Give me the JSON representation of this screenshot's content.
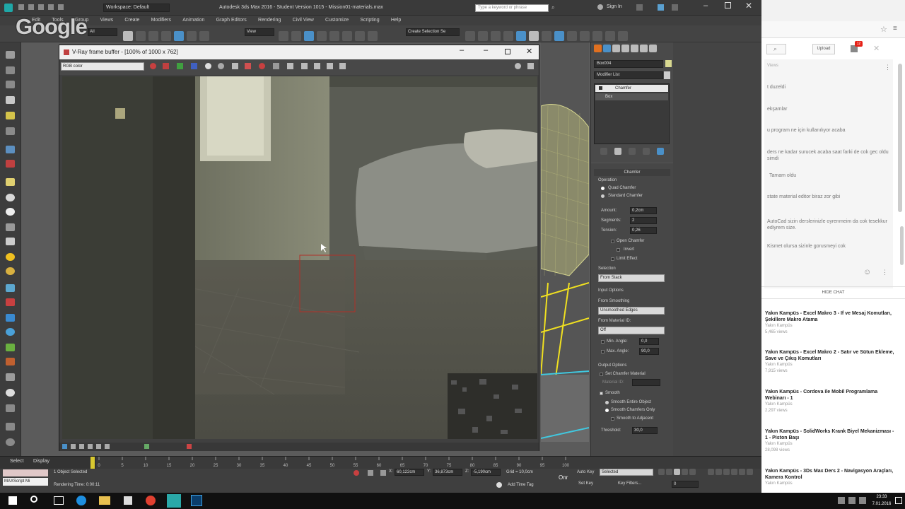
{
  "max": {
    "title": "Autodesk 3ds Max 2016 - Student Version    1015 - Mission01-materials.max",
    "workspace": "Workspace: Default",
    "search_placeholder": "Type a keyword or phrase",
    "signin": "Sign In",
    "menu": [
      "Edit",
      "Tools",
      "Group",
      "Views",
      "Create",
      "Modifiers",
      "Animation",
      "Graph Editors",
      "Rendering",
      "Civil View",
      "Customize",
      "Scripting",
      "Help"
    ],
    "selection_filter": "All",
    "ref_coord": "View",
    "named_sel": "Create Selection Se"
  },
  "vray": {
    "title": "V-Ray frame buffer - [100% of 1000 x 762]",
    "channel": "RGB color"
  },
  "cmd": {
    "object_name": "Box004",
    "modifier_list": "Modifier List",
    "stack": [
      "Chamfer",
      "Box"
    ],
    "chamfer_rollout": "Chamfer",
    "operation_label": "Operation",
    "quad_chamfer": "Quad Chamfer",
    "standard_chamfer": "Standard Chamfer",
    "amount_label": "Amount:",
    "amount": "0,2cm",
    "segments_label": "Segments:",
    "segments": "2",
    "tension_label": "Tension:",
    "tension": "0,26",
    "open_chamfer": "Open Chamfer",
    "invert": "Invert",
    "limit_effect": "Limit Effect",
    "selection_label": "Selection",
    "selection_value": "From Stack",
    "input_options": "Input Options",
    "from_smoothing": "From Smoothing",
    "smoothing_value": "Unsmoothed Edges",
    "from_material": "From Material ID:",
    "material_value": "Off",
    "min_angle_label": "Min. Angle:",
    "min_angle": "0,0",
    "max_angle_label": "Max. Angle:",
    "max_angle": "90,0",
    "output_options": "Output Options",
    "set_material": "Set Chamfer Material",
    "material_id_label": "Material ID:",
    "smooth": "Smooth",
    "smooth_entire": "Smooth Entire Object",
    "smooth_chamfers": "Smooth Chamfers Only",
    "smooth_adjacent": "Smooth to Adjacent",
    "threshold_label": "Threshold:",
    "threshold": "30,0"
  },
  "timeline": {
    "select": "Select",
    "display": "Display",
    "ticks": [
      "0",
      "5",
      "10",
      "15",
      "20",
      "25",
      "30",
      "35",
      "40",
      "45",
      "50",
      "55",
      "60",
      "65",
      "70",
      "75",
      "80",
      "85",
      "90",
      "95",
      "100"
    ]
  },
  "status": {
    "maxscript": "MAXScript Mi",
    "objects_selected": "1 Object Selected",
    "rendering_time": "Rendering Time: 0:00:11",
    "x": "60,122cm",
    "y": "36,873cm",
    "z": "-5,190cm",
    "grid": "Grid = 10,0cm",
    "add_time_tag": "Add Time Tag",
    "auto_key": "Auto Key",
    "selected": "Selected",
    "set_key": "Set Key",
    "key_filters": "Key Filters...",
    "frame": "0"
  },
  "chrome": {
    "upload": "Upload",
    "notif_count": "12",
    "chat_views": "Views",
    "chats": [
      "t duzeldi",
      "ekşamlar",
      "u program ne için kullanılıyor acaba",
      "ders ne kadar surucek acaba  saat farki de cok gec oldu simdi",
      "Tamam oldu",
      "state material editor biraz zor gibi",
      "AutoCad sizin derslerinizle oyrenmeim  da cok tesekkur ediyrem size.",
      "Kismet olursa sizinle gorusmeyi cok"
    ],
    "hide_chat": "HIDE CHAT",
    "videos": [
      {
        "title": "Yakın Kampüs - Excel Makro 3 - If ve Mesaj Komutları, Şekillere Makro Atama",
        "channel": "Yakın Kampüs",
        "views": "5,465 views"
      },
      {
        "title": "Yakın Kampüs - Excel Makro 2 - Satır ve Sütun Ekleme, Save ve Çıkış Komutları",
        "channel": "Yakın Kampüs",
        "views": "7,915 views"
      },
      {
        "title": "Yakın Kampüs - Cordova ile Mobil Programlama Webinarı - 1",
        "channel": "Yakın Kampüs",
        "views": "2,297 views"
      },
      {
        "title": "Yakın Kampüs - SolidWorks Krank Biyel Mekanizması - 1 - Piston Başı",
        "channel": "Yakın Kampüs",
        "views": "28,098 views"
      },
      {
        "title": "Yakın Kampüs - 3Ds Max Ders 2 - Navigasyon Araçları, Kamera Kontrol",
        "channel": "Yakın Kampüs",
        "views": ""
      }
    ]
  },
  "taskbar": {
    "time": "23:33",
    "date": "7.01.2016"
  },
  "watermark": "Google"
}
